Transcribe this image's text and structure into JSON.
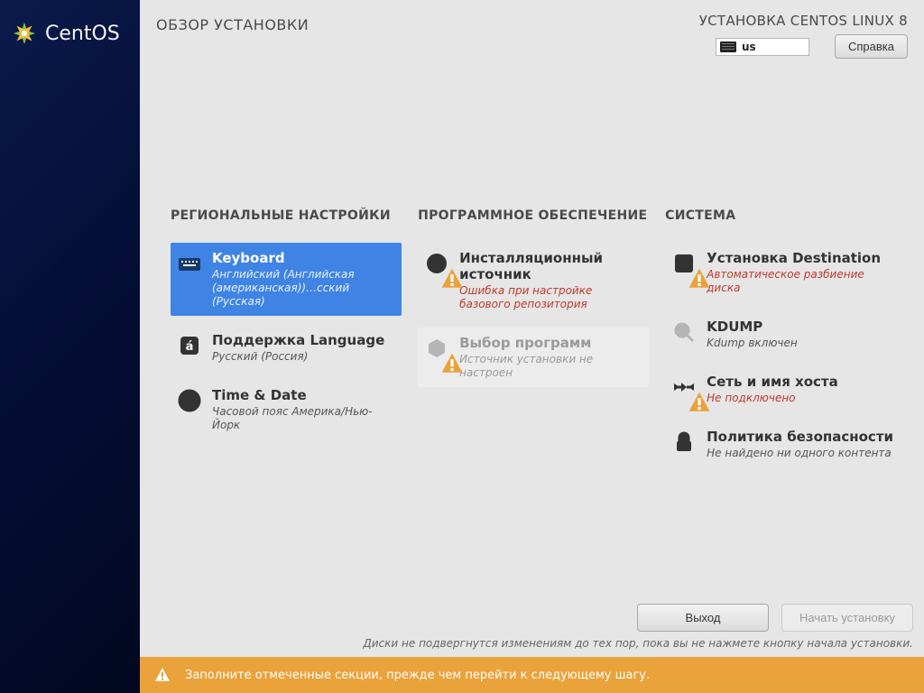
{
  "sidebar": {
    "brand": "CentOS"
  },
  "header": {
    "page_title": "ОБЗОР УСТАНОВКИ",
    "install_title": "УСТАНОВКА CENTOS LINUX 8",
    "kbd_layout": "us",
    "help_label": "Справка"
  },
  "columns": {
    "regional": {
      "heading": "РЕГИОНАЛЬНЫЕ НАСТРОЙКИ",
      "keyboard": {
        "title": "Keyboard",
        "sub": "Английский (Английская (американская))…сский (Русская)"
      },
      "language": {
        "title": "Поддержка Language",
        "sub": "Русский (Россия)"
      },
      "time": {
        "title": "Time & Date",
        "sub": "Часовой пояс Америка/Нью-Йорк"
      }
    },
    "software": {
      "heading": "ПРОГРАММНОЕ ОБЕСПЕЧЕНИЕ",
      "source": {
        "title": "Инсталляционный источник",
        "sub": "Ошибка при настройке базового репозитория"
      },
      "selection": {
        "title": "Выбор программ",
        "sub": "Источник установки не настроен"
      }
    },
    "system": {
      "heading": "СИСТЕМА",
      "destination": {
        "title": "Установка Destination",
        "sub": "Автоматическое разбиение диска"
      },
      "kdump": {
        "title": "KDUMP",
        "sub": "Kdump включен"
      },
      "network": {
        "title": "Сеть и имя хоста",
        "sub": "Не подключено"
      },
      "security": {
        "title": "Политика безопасности",
        "sub": "Не найдено ни одного контента"
      }
    }
  },
  "footer": {
    "quit_label": "Выход",
    "begin_label": "Начать установку",
    "disclaimer": "Диски не подвергнутся изменениям до тех пор, пока вы не нажмете кнопку начала установки."
  },
  "warnbar": {
    "text": "Заполните отмеченные секции, прежде чем перейти к следующему шагу."
  }
}
